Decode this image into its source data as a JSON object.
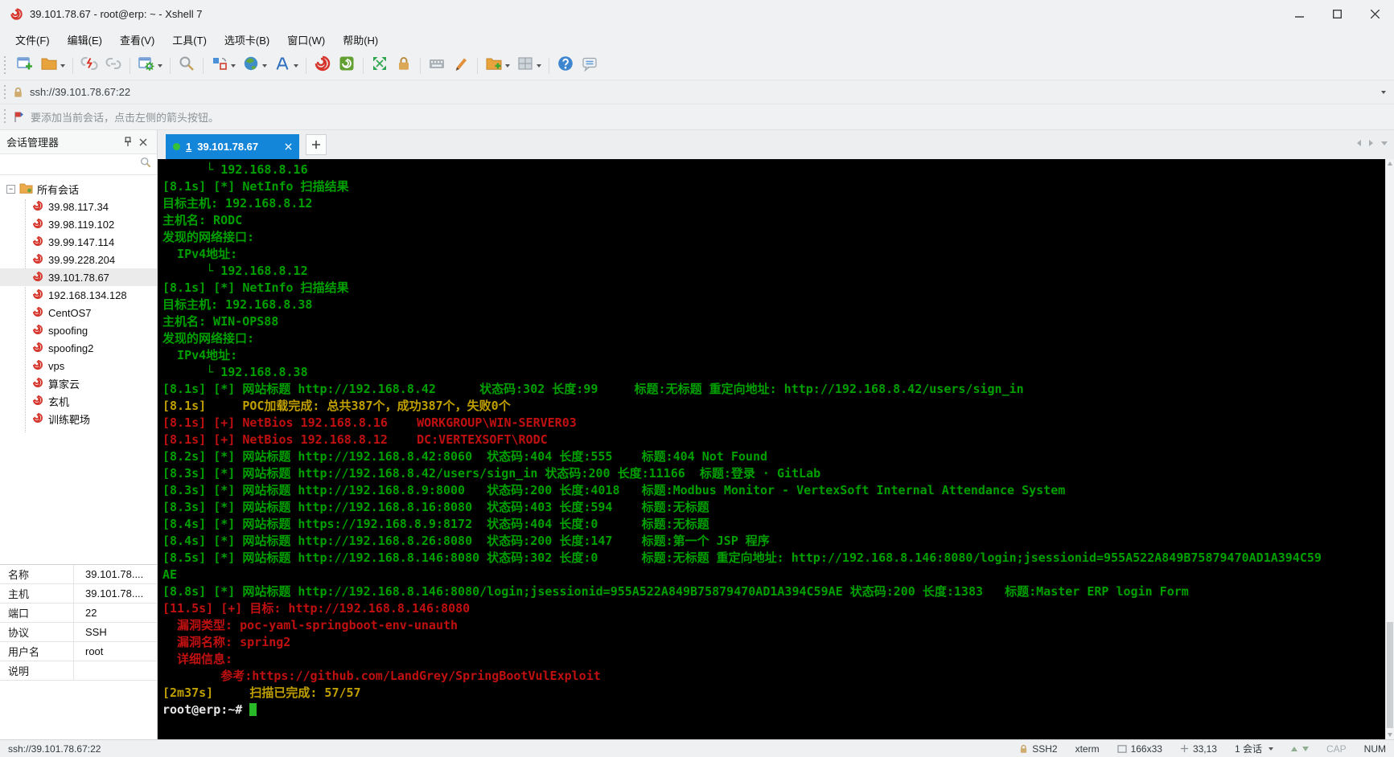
{
  "window": {
    "title": "39.101.78.67 - root@erp: ~ - Xshell 7"
  },
  "menu": {
    "items": [
      "文件(F)",
      "编辑(E)",
      "查看(V)",
      "工具(T)",
      "选项卡(B)",
      "窗口(W)",
      "帮助(H)"
    ]
  },
  "toolbar": {
    "groups": [
      [
        {
          "name": "new-session",
          "dropdown": false
        },
        {
          "name": "open-folder",
          "dropdown": true
        }
      ],
      [
        {
          "name": "disconnect",
          "dropdown": false
        },
        {
          "name": "reconnect",
          "dropdown": false
        }
      ],
      [
        {
          "name": "session-properties",
          "dropdown": true
        }
      ],
      [
        {
          "name": "find",
          "dropdown": false
        }
      ],
      [
        {
          "name": "transfer",
          "dropdown": true
        },
        {
          "name": "globe",
          "dropdown": true
        },
        {
          "name": "font",
          "dropdown": true
        }
      ],
      [
        {
          "name": "xshell",
          "dropdown": false
        },
        {
          "name": "xftp",
          "dropdown": false
        }
      ],
      [
        {
          "name": "fullscreen",
          "dropdown": false
        },
        {
          "name": "lock",
          "dropdown": false
        }
      ],
      [
        {
          "name": "keyboard",
          "dropdown": false
        },
        {
          "name": "highlighter",
          "dropdown": false
        }
      ],
      [
        {
          "name": "new-folder",
          "dropdown": true
        },
        {
          "name": "layout",
          "dropdown": true
        }
      ],
      [
        {
          "name": "help",
          "dropdown": false
        },
        {
          "name": "feedback",
          "dropdown": false
        }
      ]
    ]
  },
  "address_bar": {
    "url": "ssh://39.101.78.67:22"
  },
  "info_bar": {
    "text": "要添加当前会话，点击左侧的箭头按钮。"
  },
  "session_manager": {
    "title": "会话管理器",
    "root_label": "所有会话",
    "sessions": [
      "39.98.117.34",
      "39.98.119.102",
      "39.99.147.114",
      "39.99.228.204",
      "39.101.78.67",
      "192.168.134.128",
      "CentOS7",
      "spoofing",
      "spoofing2",
      "vps",
      "算家云",
      "玄机",
      "训练靶场"
    ],
    "selected": "39.101.78.67",
    "properties": [
      {
        "label": "名称",
        "value": "39.101.78...."
      },
      {
        "label": "主机",
        "value": "39.101.78...."
      },
      {
        "label": "端口",
        "value": "22"
      },
      {
        "label": "协议",
        "value": "SSH"
      },
      {
        "label": "用户名",
        "value": "root"
      },
      {
        "label": "说明",
        "value": ""
      }
    ]
  },
  "tabs": {
    "active_index": "1",
    "active_label": "39.101.78.67",
    "new_tab_label": "+"
  },
  "terminal": {
    "prompt": "root@erp:~# ",
    "lines": [
      {
        "c": "g",
        "text": "      └ 192.168.8.16"
      },
      {
        "c": "g",
        "text": "[8.1s] [*] NetInfo 扫描结果"
      },
      {
        "c": "g",
        "text": "目标主机: 192.168.8.12"
      },
      {
        "c": "g",
        "text": "主机名: RODC"
      },
      {
        "c": "g",
        "text": "发现的网络接口:"
      },
      {
        "c": "g",
        "text": "  IPv4地址:"
      },
      {
        "c": "g",
        "text": "      └ 192.168.8.12"
      },
      {
        "c": "g",
        "text": "[8.1s] [*] NetInfo 扫描结果"
      },
      {
        "c": "g",
        "text": "目标主机: 192.168.8.38"
      },
      {
        "c": "g",
        "text": "主机名: WIN-OPS88"
      },
      {
        "c": "g",
        "text": "发现的网络接口:"
      },
      {
        "c": "g",
        "text": "  IPv4地址:"
      },
      {
        "c": "g",
        "text": "      └ 192.168.8.38"
      },
      {
        "c": "g",
        "text": "[8.1s] [*] 网站标题 http://192.168.8.42      状态码:302 长度:99     标题:无标题 重定向地址: http://192.168.8.42/users/sign_in"
      },
      {
        "c": "y",
        "text": "[8.1s]     POC加载完成: 总共387个，成功387个，失败0个"
      },
      {
        "c": "r",
        "text": "[8.1s] [+] NetBios 192.168.8.16    WORKGROUP\\WIN-SERVER03"
      },
      {
        "c": "r",
        "text": "[8.1s] [+] NetBios 192.168.8.12    DC:VERTEXSOFT\\RODC"
      },
      {
        "c": "g",
        "text": "[8.2s] [*] 网站标题 http://192.168.8.42:8060  状态码:404 长度:555    标题:404 Not Found"
      },
      {
        "c": "g",
        "text": "[8.3s] [*] 网站标题 http://192.168.8.42/users/sign_in 状态码:200 长度:11166  标题:登录 · GitLab"
      },
      {
        "c": "g",
        "text": "[8.3s] [*] 网站标题 http://192.168.8.9:8000   状态码:200 长度:4018   标题:Modbus Monitor - VertexSoft Internal Attendance System"
      },
      {
        "c": "g",
        "text": "[8.3s] [*] 网站标题 http://192.168.8.16:8080  状态码:403 长度:594    标题:无标题"
      },
      {
        "c": "g",
        "text": "[8.4s] [*] 网站标题 https://192.168.8.9:8172  状态码:404 长度:0      标题:无标题"
      },
      {
        "c": "g",
        "text": "[8.4s] [*] 网站标题 http://192.168.8.26:8080  状态码:200 长度:147    标题:第一个 JSP 程序"
      },
      {
        "c": "g",
        "text": "[8.5s] [*] 网站标题 http://192.168.8.146:8080 状态码:302 长度:0      标题:无标题 重定向地址: http://192.168.8.146:8080/login;jsessionid=955A522A849B75879470AD1A394C59"
      },
      {
        "c": "g",
        "text": "AE"
      },
      {
        "c": "g",
        "text": "[8.8s] [*] 网站标题 http://192.168.8.146:8080/login;jsessionid=955A522A849B75879470AD1A394C59AE 状态码:200 长度:1383   标题:Master ERP login Form"
      },
      {
        "c": "r",
        "text": "[11.5s] [+] 目标: http://192.168.8.146:8080"
      },
      {
        "c": "r",
        "text": "  漏洞类型: poc-yaml-springboot-env-unauth"
      },
      {
        "c": "r",
        "text": "  漏洞名称: spring2"
      },
      {
        "c": "r",
        "text": "  详细信息:"
      },
      {
        "c": "r",
        "text": "        参考:https://github.com/LandGrey/SpringBootVulExploit"
      },
      {
        "c": "y",
        "text": "[2m37s]     扫描已完成: 57/57"
      }
    ]
  },
  "status_bar": {
    "left": "ssh://39.101.78.67:22",
    "protocol": "SSH2",
    "term_type": "xterm",
    "size": "166x33",
    "cursor_pos": "33,13",
    "session_count": "1 会话",
    "cap": "CAP",
    "num": "NUM"
  },
  "colors": {
    "terminal_green": "#00a000",
    "terminal_red": "#c01010",
    "terminal_yellow": "#c0a000",
    "terminal_white": "#e6e6e6",
    "cursor_green": "#28b828",
    "tab_blue": "#1486d9",
    "snail_red": "#d6352b"
  }
}
